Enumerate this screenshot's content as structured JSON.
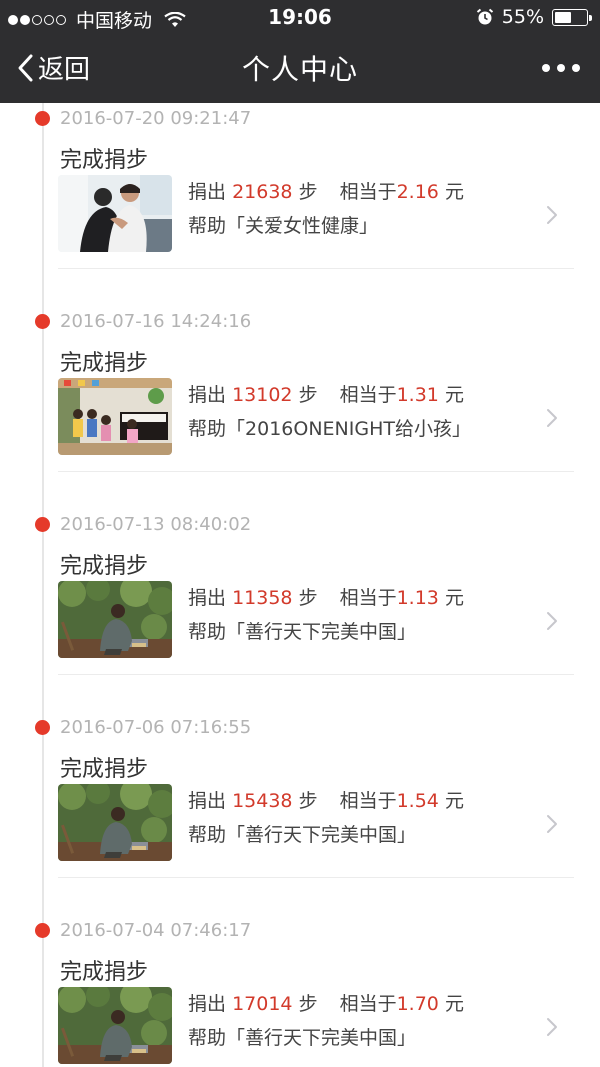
{
  "status_bar": {
    "carrier": "中国移动",
    "time": "19:06",
    "battery": "55%",
    "battery_level": 0.55,
    "signal_bars_filled": 2,
    "signal_bars_total": 5
  },
  "nav": {
    "back_label": "返回",
    "title": "个人中心"
  },
  "labels": {
    "donated": "捐出",
    "steps_unit": "步",
    "equivalent": "相当于",
    "yuan": "元",
    "help": "帮助"
  },
  "entries": [
    {
      "date": "2016-07-20 09:21:47",
      "action": "完成捐步",
      "steps": "21638",
      "amount": "2.16",
      "project": "「关爱女性健康」",
      "thumb_icon": "women-embrace-photo"
    },
    {
      "date": "2016-07-16 14:24:16",
      "action": "完成捐步",
      "steps": "13102",
      "amount": "1.31",
      "project": "「2016ONENIGHT给小孩」",
      "thumb_icon": "children-classroom-photo"
    },
    {
      "date": "2016-07-13 08:40:02",
      "action": "完成捐步",
      "steps": "11358",
      "amount": "1.13",
      "project": "「善行天下完美中国」",
      "thumb_icon": "elderly-man-garden-photo"
    },
    {
      "date": "2016-07-06 07:16:55",
      "action": "完成捐步",
      "steps": "15438",
      "amount": "1.54",
      "project": "「善行天下完美中国」",
      "thumb_icon": "elderly-man-garden-photo"
    },
    {
      "date": "2016-07-04 07:46:17",
      "action": "完成捐步",
      "steps": "17014",
      "amount": "1.70",
      "project": "「善行天下完美中国」",
      "thumb_icon": "elderly-man-garden-photo"
    }
  ],
  "colors": {
    "accent_red": "#d23a2b",
    "timeline_dot": "#e53a2a",
    "header_bg": "#2e2e30"
  }
}
